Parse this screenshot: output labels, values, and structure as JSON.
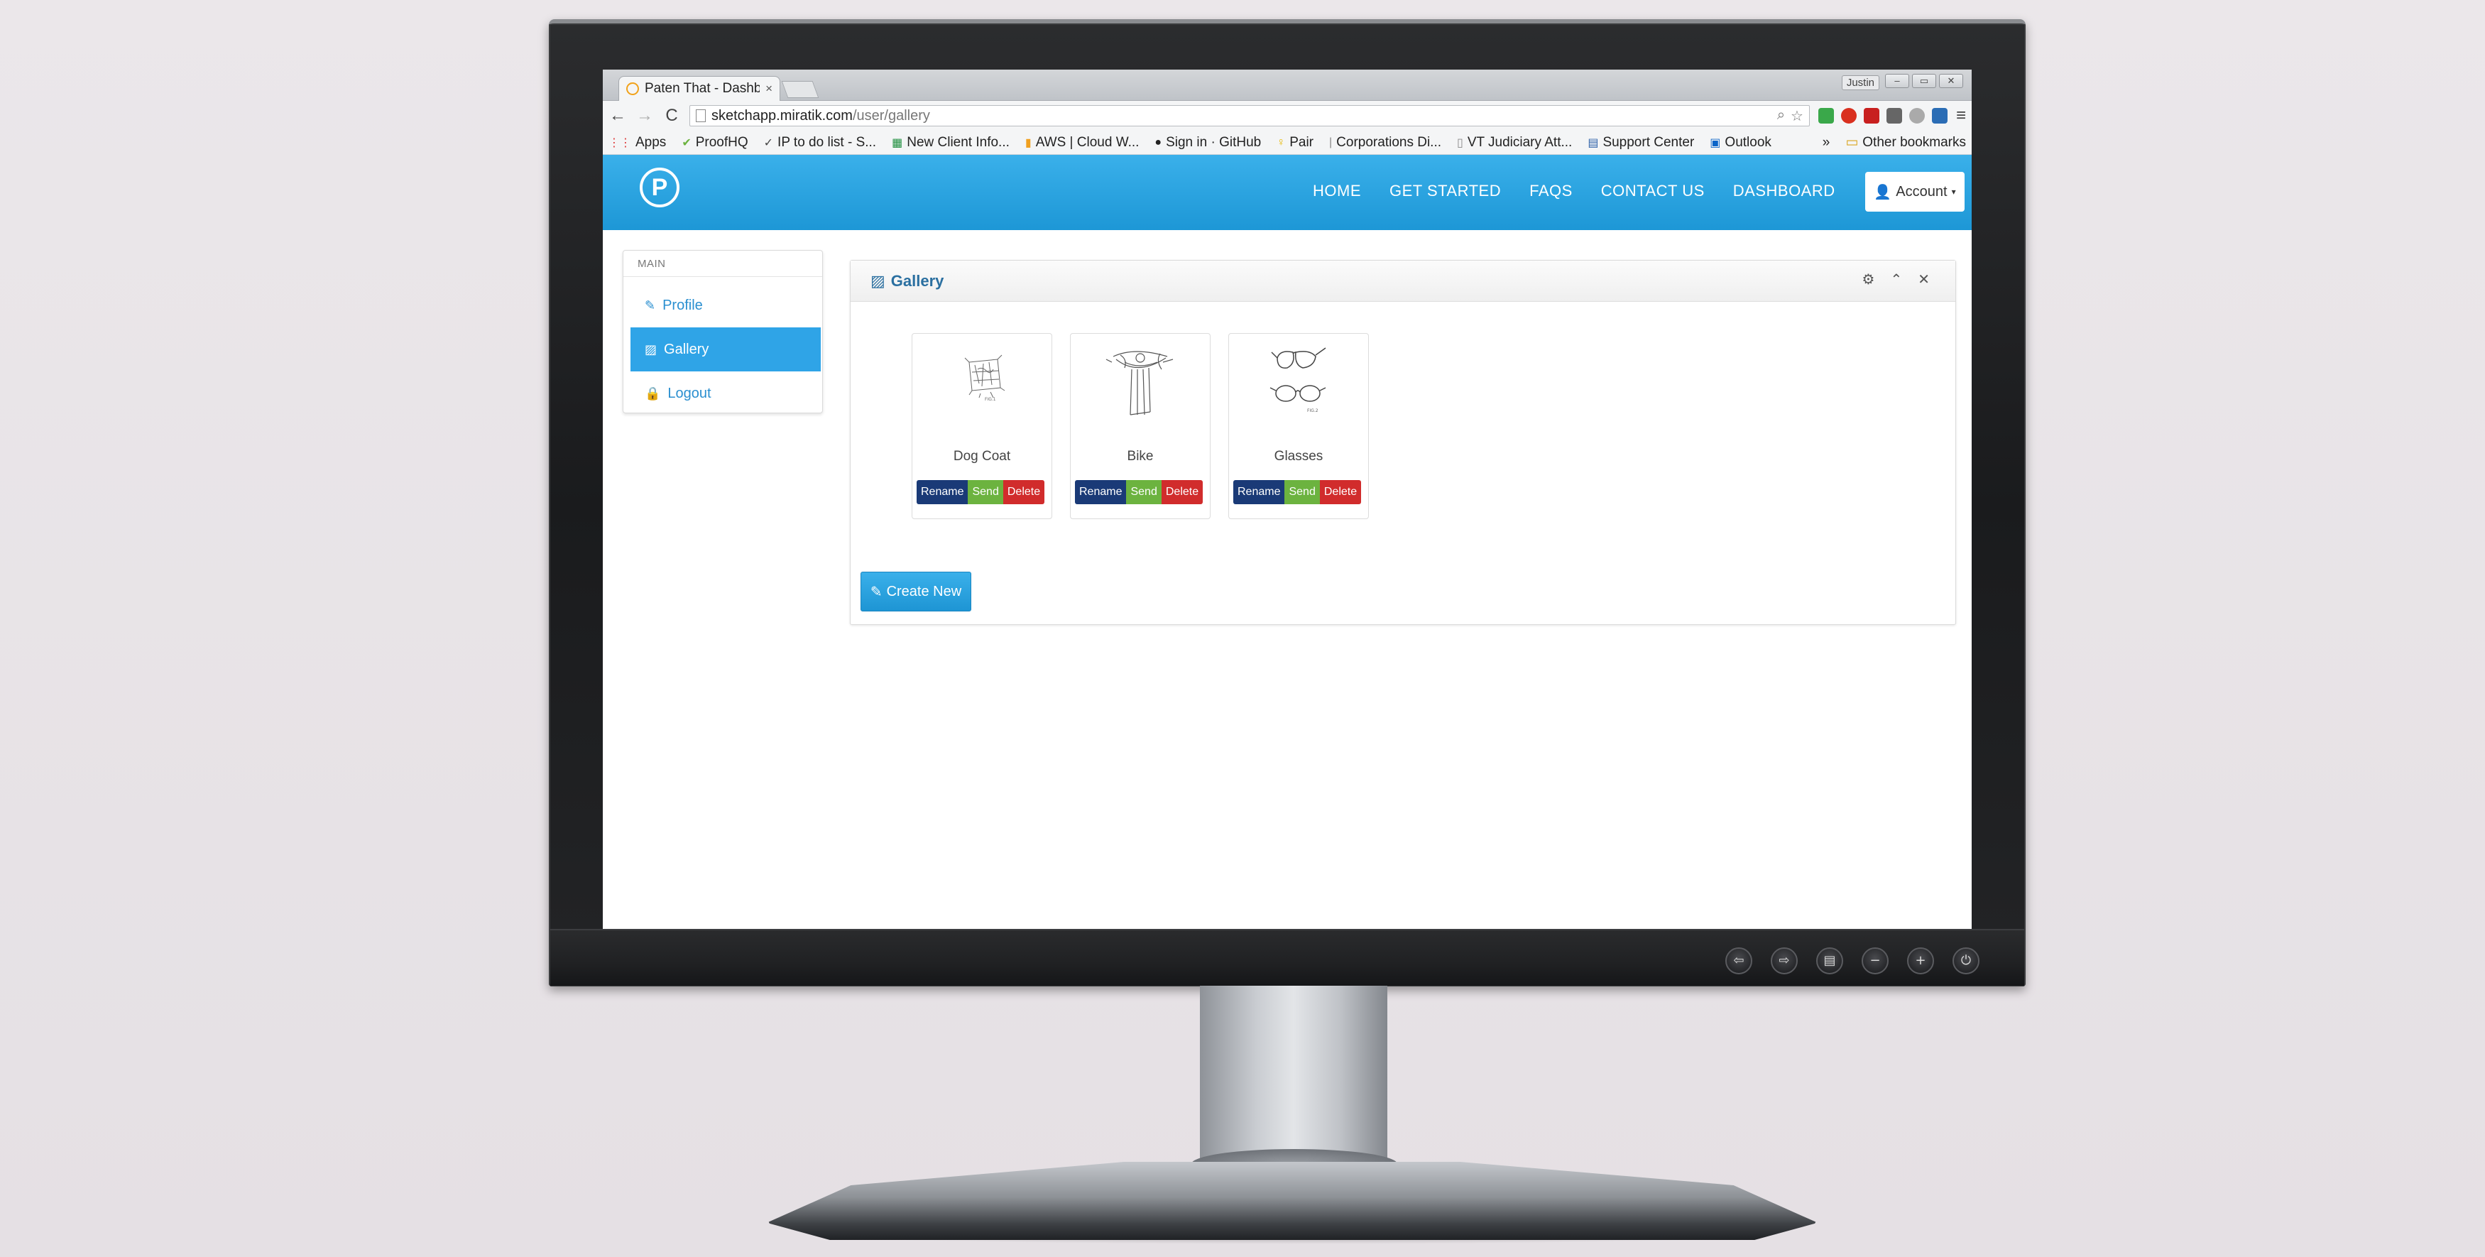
{
  "browser": {
    "tab_title": "Paten That - Dashbo",
    "tab_close": "×",
    "window_user": "Justin",
    "window_controls": [
      "–",
      "▭",
      "✕"
    ],
    "nav": {
      "back": "←",
      "forward": "→",
      "reload": "C"
    },
    "url_host": "sketchapp.miratik.com",
    "url_path": "/user/gallery",
    "menu": "≡",
    "bookmarks": [
      {
        "icon": "⋮⋮",
        "label": "Apps"
      },
      {
        "icon": "✔",
        "label": "ProofHQ"
      },
      {
        "icon": "✓",
        "label": "IP to do list - S..."
      },
      {
        "icon": "▦",
        "label": "New Client Info..."
      },
      {
        "icon": "▮",
        "label": "AWS | Cloud W..."
      },
      {
        "icon": "●",
        "label": "Sign in · GitHub"
      },
      {
        "icon": "♀",
        "label": "Pair"
      },
      {
        "icon": "|",
        "label": "Corporations Di..."
      },
      {
        "icon": "▯",
        "label": "VT Judiciary Att..."
      },
      {
        "icon": "▤",
        "label": "Support Center"
      },
      {
        "icon": "▣",
        "label": "Outlook"
      }
    ],
    "bookmarks_overflow": "»",
    "other_bookmarks": "Other bookmarks"
  },
  "site": {
    "logo_letter": "P",
    "nav": [
      "HOME",
      "GET STARTED",
      "FAQS",
      "CONTACT US",
      "DASHBOARD"
    ],
    "account_label": "Account",
    "brand_color": "#2fa4e7"
  },
  "sidebar": {
    "heading": "MAIN",
    "items": [
      {
        "label": "Profile",
        "icon": "✎",
        "active": false
      },
      {
        "label": "Gallery",
        "icon": "▨",
        "active": true
      },
      {
        "label": "Logout",
        "icon": "🔒",
        "active": false
      }
    ]
  },
  "gallery": {
    "title": "Gallery",
    "tools": [
      "⚙",
      "⌃",
      "✕"
    ],
    "cards": [
      {
        "title": "Dog Coat"
      },
      {
        "title": "Bike"
      },
      {
        "title": "Glasses"
      }
    ],
    "actions": {
      "rename": "Rename",
      "send": "Send",
      "delete": "Delete"
    },
    "create_new": "Create New"
  },
  "monitor_controls": [
    "⇦",
    "⇨",
    "▤",
    "−",
    "+",
    "⏻"
  ]
}
